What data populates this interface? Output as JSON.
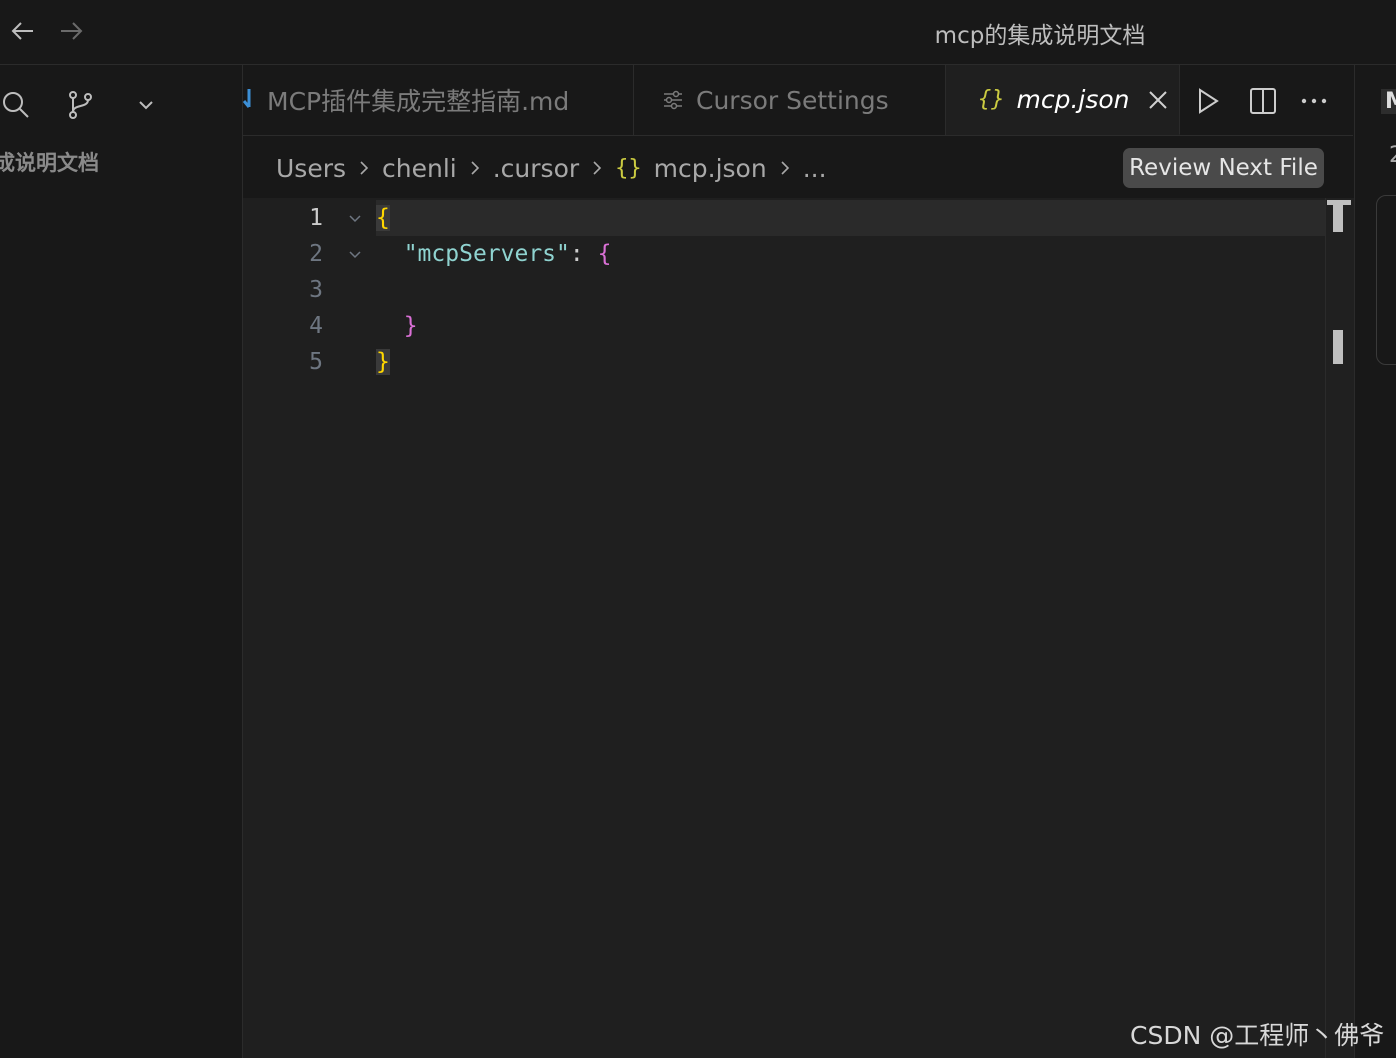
{
  "window": {
    "title": "mcp的集成说明文档"
  },
  "sidebar": {
    "label": "成说明文档"
  },
  "tabs": [
    {
      "label": "MCP插件集成完整指南.md",
      "icon": "markdown-icon",
      "active": false
    },
    {
      "label": "Cursor Settings",
      "icon": "settings-sliders-icon",
      "active": false
    },
    {
      "label": "mcp.json",
      "icon": "{}",
      "active": true
    }
  ],
  "breadcrumb": {
    "items": [
      "Users",
      "chenli",
      ".cursor",
      "mcp.json",
      "..."
    ],
    "file_icon": "{}"
  },
  "review_button": {
    "label": "Review Next File"
  },
  "editor": {
    "lines": [
      {
        "number": "1",
        "text": "{"
      },
      {
        "number": "2",
        "key": "\"mcpServers\"",
        "colon": ": ",
        "open": "{"
      },
      {
        "number": "3",
        "text": ""
      },
      {
        "number": "4",
        "text": "}"
      },
      {
        "number": "5",
        "text": "}"
      }
    ]
  },
  "right_panel": {
    "fragment_top": "M",
    "fragment_num": "2"
  },
  "watermark": {
    "text": "CSDN @工程师丶佛爷"
  },
  "colors": {
    "background": "#181818",
    "editor_bg": "#1f1f1f",
    "brace_outer": "#ffd700",
    "brace_inner": "#da70d6",
    "string": "#8fd3d0",
    "json_icon": "#cbcb41"
  }
}
